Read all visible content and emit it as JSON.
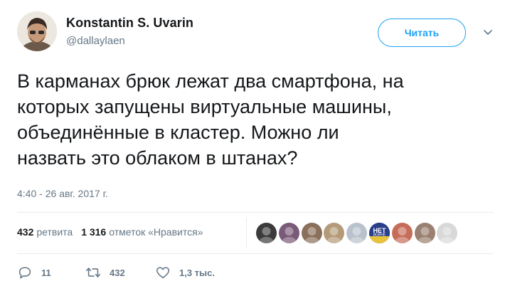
{
  "author": {
    "name": "Konstantin S. Uvarin",
    "handle": "@dallaylaen",
    "avatar_icon": "user-avatar-photo"
  },
  "follow_button": {
    "label": "Читать"
  },
  "tweet": {
    "text": "В карманах брюк лежат два смартфона, на\nкоторых запущены виртуальные машины,\nобъединённые в кластер. Можно ли\nназвать это облаком в штанах?",
    "timestamp": "4:40 - 26 авг. 2017 г."
  },
  "stats": {
    "retweets_count": "432",
    "retweets_label": "ретвита",
    "likes_count": "1 316",
    "likes_label": "отметок «Нравится»"
  },
  "liker_avatars": [
    {
      "icon": "liker-avatar-icon",
      "color": "#3b3b3b"
    },
    {
      "icon": "liker-avatar-icon",
      "color": "#7a5a78"
    },
    {
      "icon": "liker-avatar-icon",
      "color": "#8a6f5a"
    },
    {
      "icon": "liker-avatar-icon",
      "color": "#b49a78"
    },
    {
      "icon": "liker-avatar-icon",
      "color": "#b9c2cc"
    },
    {
      "icon": "liker-avatar-icon",
      "color": "#2a3f8a",
      "badge_top": "НЕТ",
      "badge_bottom": "ВОЙНЕ"
    },
    {
      "icon": "liker-avatar-icon",
      "color": "#c66d5a"
    },
    {
      "icon": "liker-avatar-icon",
      "color": "#9a8070"
    },
    {
      "icon": "liker-avatar-icon",
      "color": "#d8d8d8"
    }
  ],
  "actions": {
    "reply_count": "11",
    "retweet_count": "432",
    "like_count": "1,3 тыс."
  },
  "colors": {
    "accent": "#1da1f2",
    "secondary_text": "#657786",
    "primary_text": "#14171a",
    "divider": "#e6ecf0"
  }
}
